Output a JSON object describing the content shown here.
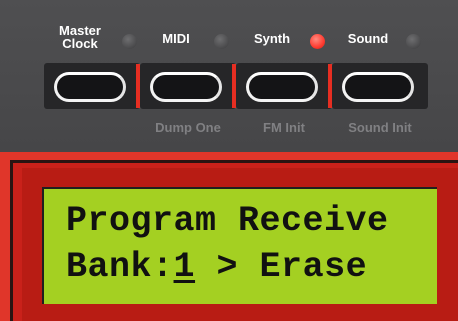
{
  "buttons": [
    {
      "label_line1": "Master",
      "label_line2": "Clock",
      "led": "off",
      "sub_label": ""
    },
    {
      "label_line1": "MIDI",
      "label_line2": "",
      "led": "off",
      "sub_label": "Dump One"
    },
    {
      "label_line1": "Synth",
      "label_line2": "",
      "led": "on",
      "sub_label": "FM Init"
    },
    {
      "label_line1": "Sound",
      "label_line2": "",
      "led": "off",
      "sub_label": "Sound Init"
    }
  ],
  "lcd": {
    "line1": "Program Receive",
    "line2_prefix": "Bank:",
    "line2_value": "1",
    "line2_suffix": " > Erase"
  },
  "colors": {
    "panel": "#4a4a4c",
    "led_on": "#ff3b30",
    "lcd_background": "#a4d022",
    "frame_red": "#e0362a"
  }
}
